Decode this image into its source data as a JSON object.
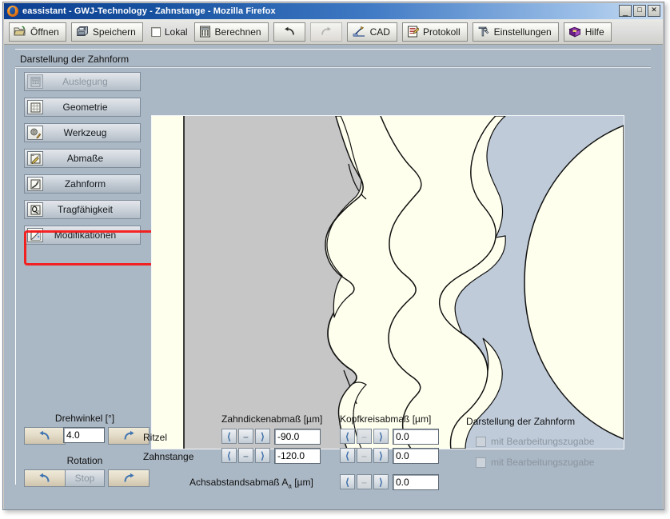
{
  "window": {
    "title": "eassistant - GWJ-Technology - Zahnstange - Mozilla Firefox",
    "app_icon": "firefox-icon",
    "minimize_label": "_",
    "maximize_label": "□",
    "close_label": "✕"
  },
  "toolbar": {
    "buttons": [
      {
        "label": "Öffnen",
        "icon": "open-folder-icon",
        "enabled": true
      },
      {
        "label": "Speichern",
        "icon": "floppy-disk-icon",
        "enabled": true
      },
      {
        "label": "Berechnen",
        "icon": "calculator-icon",
        "enabled": true
      },
      {
        "label": "CAD",
        "icon": "cad-icon",
        "enabled": true
      },
      {
        "label": "Protokoll",
        "icon": "document-pencil-icon",
        "enabled": true
      },
      {
        "label": "Einstellungen",
        "icon": "tools-icon",
        "enabled": true
      },
      {
        "label": "Hilfe",
        "icon": "book-icon",
        "enabled": true
      }
    ],
    "lokal_checkbox_label": "Lokal",
    "lokal_checked": false,
    "undo_icon": "undo-arrow-icon",
    "redo_icon": "redo-arrow-icon",
    "undo_enabled": true,
    "redo_enabled": false
  },
  "panel": {
    "header": "Darstellung der Zahnform"
  },
  "sidebar": {
    "items": [
      {
        "label": "Auslegung",
        "icon": "calculator-icon",
        "enabled": false,
        "selected": false
      },
      {
        "label": "Geometrie",
        "icon": "grid-icon",
        "enabled": true,
        "selected": false
      },
      {
        "label": "Werkzeug",
        "icon": "gear-tool-icon",
        "enabled": true,
        "selected": false
      },
      {
        "label": "Abmaße",
        "icon": "ruler-pencil-icon",
        "enabled": true,
        "selected": false
      },
      {
        "label": "Zahnform",
        "icon": "tooth-curve-icon",
        "enabled": true,
        "selected": true
      },
      {
        "label": "Tragfähigkeit",
        "icon": "sigma-x-icon",
        "enabled": true,
        "selected": false
      },
      {
        "label": "Modifikationen",
        "icon": "modify-icon",
        "enabled": true,
        "selected": false
      }
    ]
  },
  "annotation": {
    "target": "Zahnform",
    "color": "#f71414"
  },
  "drawing": {
    "name": "zahnform-diagram",
    "colors": {
      "background": "#ffffee",
      "rack": "#c6c6c6",
      "gear": "#bfcbd9",
      "outline": "#000000"
    },
    "description": "Zahnstange (rack) meshing with Ritzel (pinion) tooth form"
  },
  "controls": {
    "rotation_group": {
      "angle_label": "Drehwinkel [°]",
      "angle_value": "4.0",
      "ccw_icon": "rotate-ccw-icon",
      "cw_icon": "rotate-cw-icon",
      "rotation_label": "Rotation",
      "stop_label": "Stop",
      "stop_enabled": false
    },
    "row_labels": [
      "Ritzel",
      "Zahnstange"
    ],
    "columns": [
      {
        "header": "Zahndickenabmaß [µm]",
        "values": [
          "-90.0",
          "-120.0"
        ]
      },
      {
        "header": "Kopfkreisabmaß [µm]",
        "values": [
          "0.0",
          "0.0"
        ]
      }
    ],
    "axis_row": {
      "label_main": "Achsabstandsabmaß A",
      "label_sub": "a",
      "label_unit": " [µm]",
      "value": "0.0"
    },
    "spinner": {
      "left_icon": "chevron-left-icon",
      "mid_icon": "minus-icon",
      "right_icon": "chevron-right-icon"
    }
  },
  "display_options": {
    "title": "Darstellung der Zahnform",
    "checkboxes": [
      {
        "label": "mit Bearbeitungszugabe",
        "checked": false,
        "enabled": false
      },
      {
        "label": "mit Bearbeitungszugabe",
        "checked": false,
        "enabled": false
      }
    ]
  }
}
